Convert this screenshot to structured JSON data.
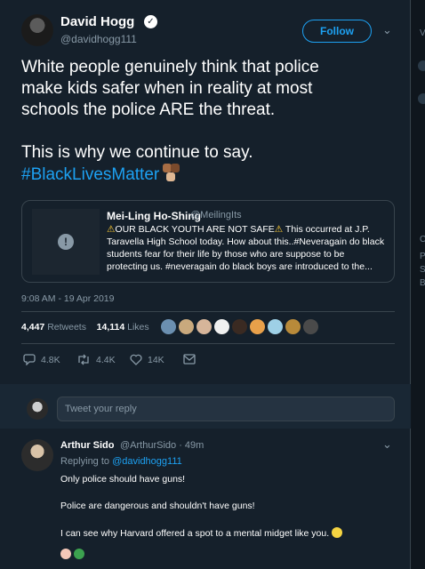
{
  "tweet": {
    "author_name": "David Hogg",
    "author_handle": "@davidhogg111",
    "follow_label": "Follow",
    "text_line1": "White people genuinely think that police",
    "text_line2": "make kids safer when in reality at most",
    "text_line3": "schools the police ARE the threat.",
    "text_line4": "This is why we continue to say.",
    "hashtag": "#BlackLivesMatter",
    "timestamp": "9:08 AM - 19 Apr 2019",
    "retweets_count": "4,447",
    "retweets_label": "Retweets",
    "likes_count": "14,114",
    "likes_label": "Likes",
    "reply_count": "4.8K",
    "retweet_action_count": "4.4K",
    "like_action_count": "14K"
  },
  "quote": {
    "name": "Mei-Ling Ho-Shing",
    "handle": "@MeilingIts",
    "line1": "OUR BLACK YOUTH ARE NOT SAFE",
    "line1_rest": " This occurred at J.P.",
    "line2": "Taravella High School today. How about this..#Neveragain do black",
    "line3": "students fear for their life  by those who are suppose to be",
    "line4": "protecting us. #neveragain do black boys are introduced to the..."
  },
  "composer": {
    "placeholder": "Tweet your reply"
  },
  "reply": {
    "name": "Arthur Sido",
    "meta": "@ArthurSido · 49m",
    "replying_prefix": "Replying to ",
    "replying_handle": "@davidhogg111",
    "line1": "Only police should have guns!",
    "line2": "Police are dangerous and shouldn't have guns!",
    "line3": "I can see why Harvard offered a spot to a mental midget like you."
  },
  "gutter": {
    "letter_v": "V",
    "letter_c": "C",
    "letter_p": "P",
    "letter_s": "S",
    "letter_b": "B"
  },
  "colors": {
    "background": "#15202b",
    "accent": "#1da1f2",
    "muted": "#8899a6",
    "border": "#38444d"
  }
}
